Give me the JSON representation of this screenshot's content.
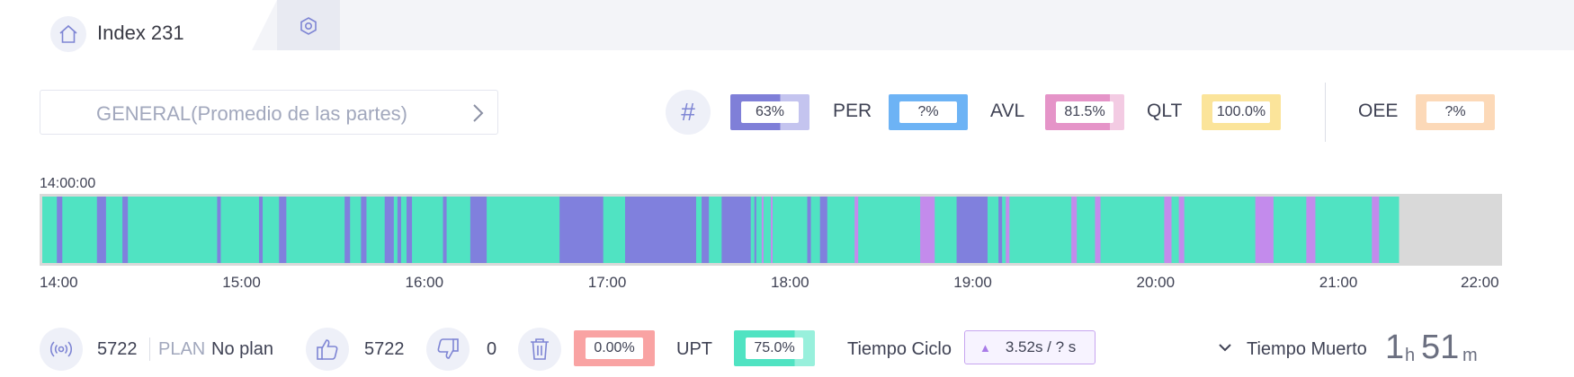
{
  "tab": {
    "title": "Index 231",
    "home_icon": "home-icon",
    "settings_icon": "settings-hex-icon"
  },
  "part_selector": {
    "label": "GENERAL(Promedio de las partes)",
    "icon": "chevron-right-icon"
  },
  "metrics": {
    "hash_symbol": "#",
    "main": {
      "value": "63%",
      "fraction": 0.63,
      "color": "#7f7fd8",
      "track": "#c4c4ef"
    },
    "per": {
      "label": "PER",
      "value": "?%",
      "fraction": 1.0,
      "color": "#6db3f5",
      "track": "#6db3f5"
    },
    "avl": {
      "label": "AVL",
      "value": "81.5%",
      "fraction": 0.815,
      "color": "#e594c8",
      "track": "#f3cbe3"
    },
    "qlt": {
      "label": "QLT",
      "value": "100.0%",
      "fraction": 1.0,
      "color": "#fbe49a",
      "track": "#fbe49a"
    },
    "oee": {
      "label": "OEE",
      "value": "?%",
      "fraction": 1.0,
      "color": "#fcd9b8",
      "track": "#fcd9b8"
    }
  },
  "timeline": {
    "start_label": "14:00:00",
    "range_hours": [
      14,
      22
    ],
    "ticks": [
      "14:00",
      "15:00",
      "16:00",
      "17:00",
      "18:00",
      "19:00",
      "20:00",
      "21:00",
      "22:00"
    ],
    "colors": {
      "running": "#50e3c2",
      "stopped": "#8080dd",
      "microstop": "#c38bec",
      "no_data": "#d9d9d9"
    },
    "data_end_hour": 21.45,
    "events": [
      {
        "start": 14.08,
        "end": 14.11,
        "type": "stopped"
      },
      {
        "start": 14.3,
        "end": 14.35,
        "type": "stopped"
      },
      {
        "start": 14.44,
        "end": 14.47,
        "type": "stopped"
      },
      {
        "start": 14.96,
        "end": 14.98,
        "type": "stopped"
      },
      {
        "start": 15.19,
        "end": 15.21,
        "type": "stopped"
      },
      {
        "start": 15.3,
        "end": 15.34,
        "type": "stopped"
      },
      {
        "start": 15.66,
        "end": 15.69,
        "type": "stopped"
      },
      {
        "start": 15.75,
        "end": 15.78,
        "type": "stopped"
      },
      {
        "start": 15.88,
        "end": 15.93,
        "type": "stopped"
      },
      {
        "start": 15.95,
        "end": 15.97,
        "type": "stopped"
      },
      {
        "start": 16.0,
        "end": 16.03,
        "type": "stopped"
      },
      {
        "start": 16.2,
        "end": 16.22,
        "type": "stopped"
      },
      {
        "start": 16.35,
        "end": 16.44,
        "type": "stopped"
      },
      {
        "start": 16.84,
        "end": 17.08,
        "type": "stopped"
      },
      {
        "start": 17.2,
        "end": 17.59,
        "type": "stopped"
      },
      {
        "start": 17.62,
        "end": 17.66,
        "type": "stopped"
      },
      {
        "start": 17.73,
        "end": 17.89,
        "type": "stopped"
      },
      {
        "start": 17.91,
        "end": 17.92,
        "type": "stopped"
      },
      {
        "start": 17.95,
        "end": 17.96,
        "type": "microstop"
      },
      {
        "start": 18.0,
        "end": 18.01,
        "type": "microstop"
      },
      {
        "start": 18.2,
        "end": 18.22,
        "type": "stopped"
      },
      {
        "start": 18.27,
        "end": 18.31,
        "type": "stopped"
      },
      {
        "start": 18.46,
        "end": 18.48,
        "type": "microstop"
      },
      {
        "start": 18.82,
        "end": 18.9,
        "type": "microstop"
      },
      {
        "start": 19.02,
        "end": 19.19,
        "type": "stopped"
      },
      {
        "start": 19.25,
        "end": 19.27,
        "type": "stopped"
      },
      {
        "start": 19.29,
        "end": 19.31,
        "type": "microstop"
      },
      {
        "start": 19.65,
        "end": 19.68,
        "type": "microstop"
      },
      {
        "start": 19.78,
        "end": 19.81,
        "type": "microstop"
      },
      {
        "start": 20.16,
        "end": 20.2,
        "type": "microstop"
      },
      {
        "start": 20.24,
        "end": 20.27,
        "type": "microstop"
      },
      {
        "start": 20.66,
        "end": 20.76,
        "type": "microstop"
      },
      {
        "start": 20.94,
        "end": 20.99,
        "type": "microstop"
      },
      {
        "start": 21.3,
        "end": 21.34,
        "type": "microstop"
      }
    ]
  },
  "bottom": {
    "signal_icon": "signal-icon",
    "count": "5722",
    "plan_label": "PLAN",
    "plan_value": "No plan",
    "good_icon": "thumbs-up-icon",
    "good_count": "5722",
    "bad_icon": "thumbs-down-icon",
    "bad_count": "0",
    "scrap_icon": "trash-icon",
    "scrap_pct": {
      "value": "0.00%",
      "color": "#f9a3a3"
    },
    "upt_label": "UPT",
    "upt": {
      "value": "75.0%",
      "fraction": 0.75,
      "color": "#50e3c2",
      "track": "#98f0dc"
    },
    "ciclo_label": "Tiempo Ciclo",
    "ciclo_value": "3.52s / ? s",
    "muerto_label": "Tiempo Muerto",
    "muerto_hours": "1",
    "muerto_h_unit": "h",
    "muerto_minutes": "51",
    "muerto_m_unit": "m"
  }
}
